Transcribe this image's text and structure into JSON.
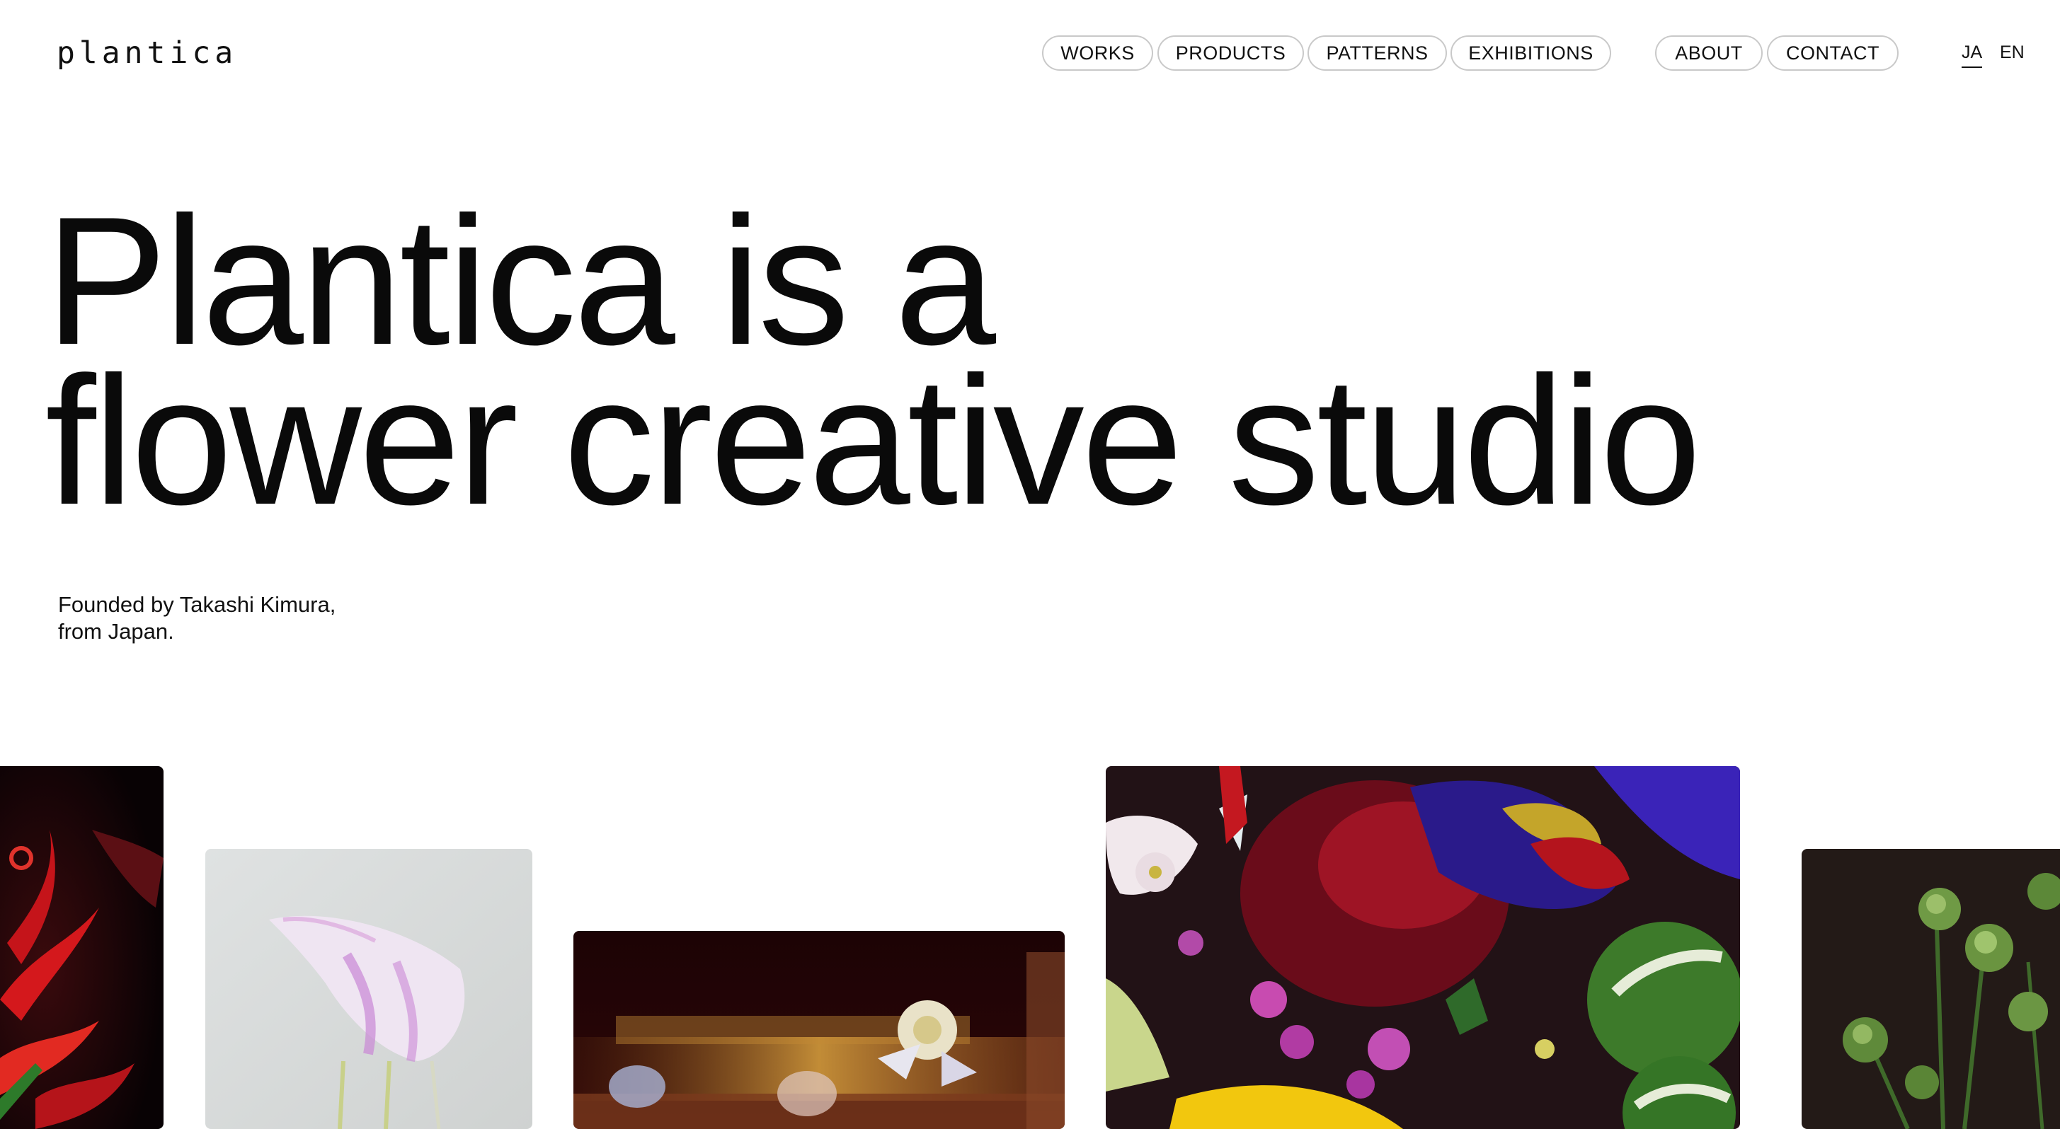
{
  "site": {
    "logo": "plantica"
  },
  "nav": {
    "primary": [
      "WORKS",
      "PRODUCTS",
      "PATTERNS",
      "EXHIBITIONS"
    ],
    "secondary": [
      "ABOUT",
      "CONTACT"
    ],
    "languages": [
      "JA",
      "EN"
    ],
    "active_language": "JA"
  },
  "hero": {
    "line1": "Plantica is a",
    "line2": "flower creative studio",
    "founded_line1": "Founded by Takashi Kimura,",
    "founded_line2": "from Japan."
  },
  "gallery": {
    "images": [
      {
        "name": "red-lily-image",
        "colors": [
          "#0d0406",
          "#d11a1c"
        ]
      },
      {
        "name": "pale-pink-petal-image",
        "colors": [
          "#d9dcdc",
          "#e7c4e5"
        ]
      },
      {
        "name": "blurred-flowers-image",
        "colors": [
          "#200305",
          "#c8872e"
        ]
      },
      {
        "name": "mixed-bouquet-image",
        "colors": [
          "#251318",
          "#4a1fb0"
        ]
      },
      {
        "name": "green-buds-image",
        "colors": [
          "#231a17",
          "#5f8a3a"
        ]
      }
    ]
  }
}
